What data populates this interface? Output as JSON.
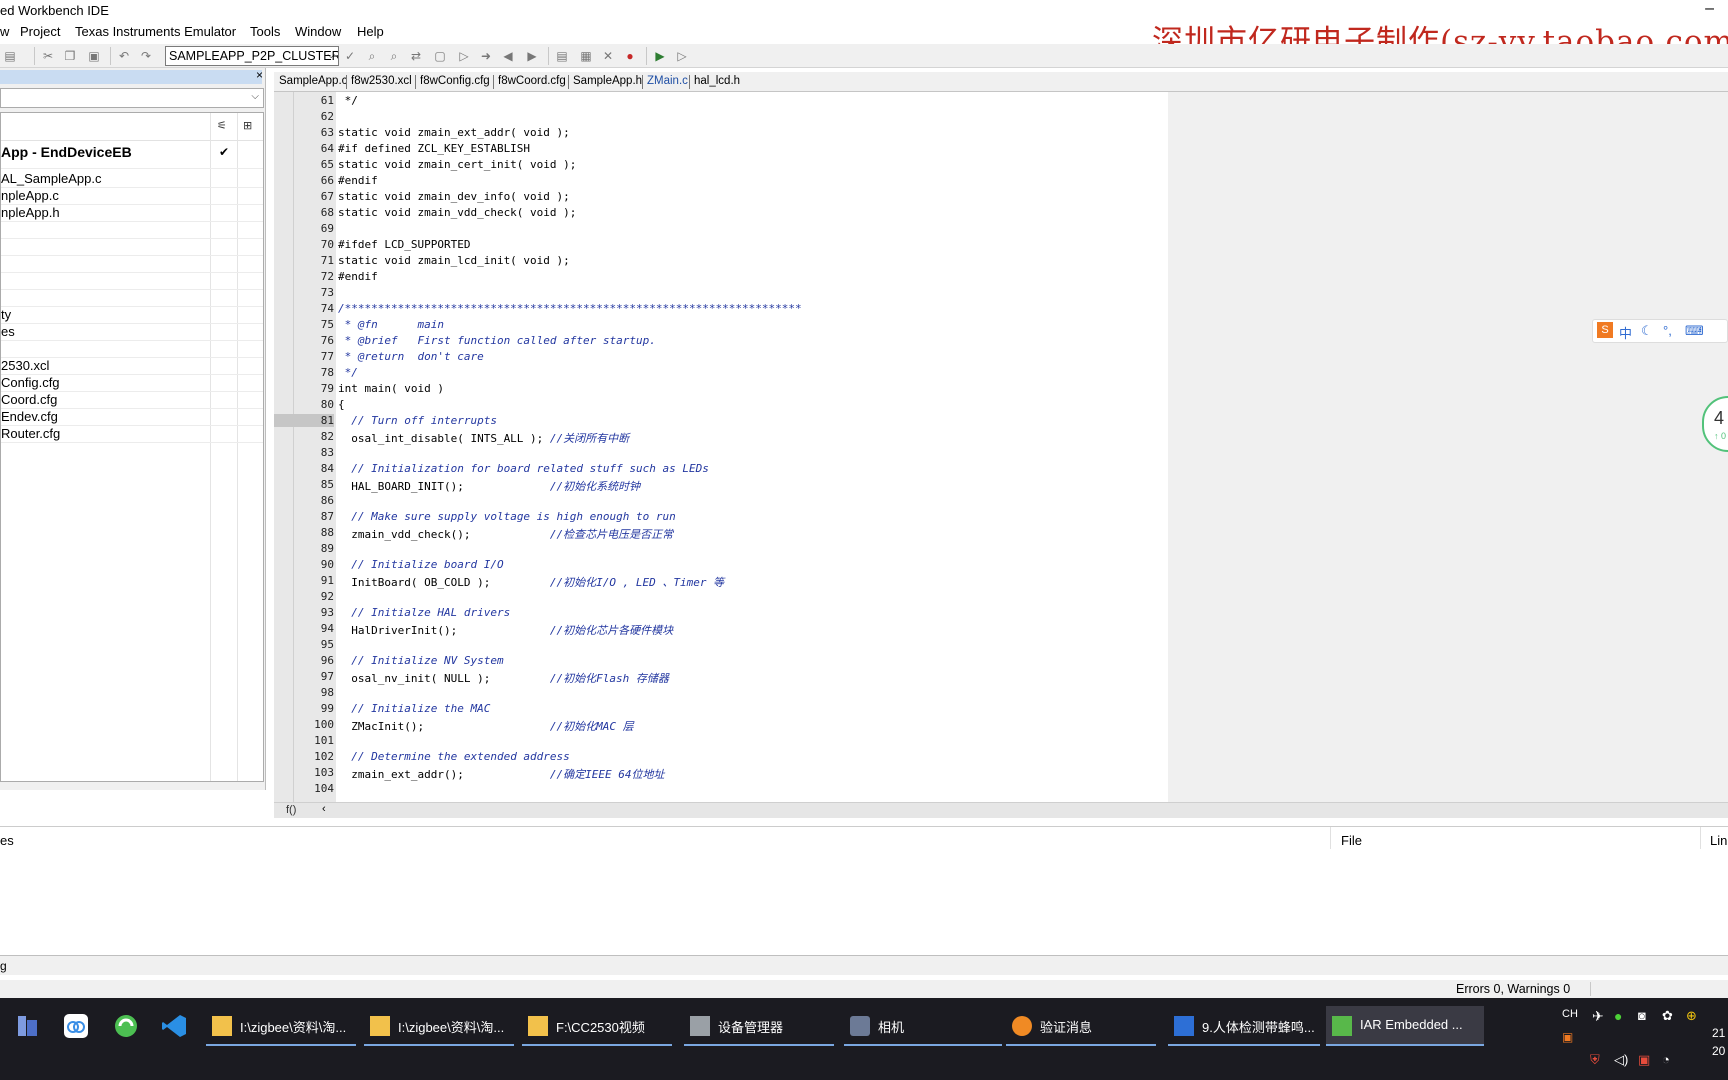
{
  "window": {
    "title": "ed Workbench IDE",
    "minimize_glyph": "–"
  },
  "menu": [
    "w",
    "Project",
    "Texas Instruments Emulator",
    "Tools",
    "Window",
    "Help"
  ],
  "watermark": "深圳市亿研电子制作(sz-yy.taobao.com",
  "toolbar": {
    "config_combo": "SAMPLEAPP_P2P_CLUSTER"
  },
  "workspace": {
    "close_glyph": "×",
    "project": "App - EndDeviceEB",
    "check": "✔",
    "files": [
      "AL_SampleApp.c",
      "npleApp.c",
      "npleApp.h",
      "",
      "",
      "",
      "",
      "",
      "ty",
      "es",
      "",
      "2530.xcl",
      "Config.cfg",
      "Coord.cfg",
      "Endev.cfg",
      "Router.cfg"
    ]
  },
  "tabs": [
    "SampleApp.c",
    "f8w2530.xcl",
    "f8wConfig.cfg",
    "f8wCoord.cfg",
    "SampleApp.h",
    "ZMain.c",
    "hal_lcd.h"
  ],
  "active_tab": "ZMain.c",
  "editor": {
    "current_line": 81,
    "lines": [
      {
        "n": "61",
        "code": " */",
        "cm": ""
      },
      {
        "n": "62",
        "code": "",
        "cm": ""
      },
      {
        "n": "63",
        "code": "static void zmain_ext_addr( void );",
        "cm": ""
      },
      {
        "n": "64",
        "code": "#if defined ZCL_KEY_ESTABLISH",
        "cm": ""
      },
      {
        "n": "65",
        "code": "static void zmain_cert_init( void );",
        "cm": ""
      },
      {
        "n": "66",
        "code": "#endif",
        "cm": ""
      },
      {
        "n": "67",
        "code": "static void zmain_dev_info( void );",
        "cm": ""
      },
      {
        "n": "68",
        "code": "static void zmain_vdd_check( void );",
        "cm": ""
      },
      {
        "n": "69",
        "code": "",
        "cm": ""
      },
      {
        "n": "70",
        "code": "#ifdef LCD_SUPPORTED",
        "cm": ""
      },
      {
        "n": "71",
        "code": "static void zmain_lcd_init( void );",
        "cm": ""
      },
      {
        "n": "72",
        "code": "#endif",
        "cm": ""
      },
      {
        "n": "73",
        "code": "",
        "cm": ""
      },
      {
        "n": "74",
        "code": "",
        "cm": "/*********************************************************************"
      },
      {
        "n": "75",
        "code": "",
        "cm": " * @fn      main"
      },
      {
        "n": "76",
        "code": "",
        "cm": " * @brief   First function called after startup."
      },
      {
        "n": "77",
        "code": "",
        "cm": " * @return  don't care"
      },
      {
        "n": "78",
        "code": "",
        "cm": " */"
      },
      {
        "n": "79",
        "code": "int main( void )",
        "cm": ""
      },
      {
        "n": "80",
        "code": "{",
        "cm": ""
      },
      {
        "n": "81",
        "code": "  ",
        "cm": "// Turn off interrupts"
      },
      {
        "n": "82",
        "code": "  osal_int_disable( INTS_ALL ); ",
        "cm": "//关闭所有中断"
      },
      {
        "n": "83",
        "code": "",
        "cm": ""
      },
      {
        "n": "84",
        "code": "  ",
        "cm": "// Initialization for board related stuff such as LEDs"
      },
      {
        "n": "85",
        "code": "  HAL_BOARD_INIT();             ",
        "cm": "//初始化系统时钟"
      },
      {
        "n": "86",
        "code": "",
        "cm": ""
      },
      {
        "n": "87",
        "code": "  ",
        "cm": "// Make sure supply voltage is high enough to run"
      },
      {
        "n": "88",
        "code": "  zmain_vdd_check();            ",
        "cm": "//检查芯片电压是否正常"
      },
      {
        "n": "89",
        "code": "",
        "cm": ""
      },
      {
        "n": "90",
        "code": "  ",
        "cm": "// Initialize board I/O"
      },
      {
        "n": "91",
        "code": "  InitBoard( OB_COLD );         ",
        "cm": "//初始化I/O , LED 、Timer 等"
      },
      {
        "n": "92",
        "code": "",
        "cm": ""
      },
      {
        "n": "93",
        "code": "  ",
        "cm": "// Initialze HAL drivers"
      },
      {
        "n": "94",
        "code": "  HalDriverInit();              ",
        "cm": "//初始化芯片各硬件模块"
      },
      {
        "n": "95",
        "code": "",
        "cm": ""
      },
      {
        "n": "96",
        "code": "  ",
        "cm": "// Initialize NV System"
      },
      {
        "n": "97",
        "code": "  osal_nv_init( NULL );         ",
        "cm": "//初始化Flash 存储器"
      },
      {
        "n": "98",
        "code": "",
        "cm": ""
      },
      {
        "n": "99",
        "code": "  ",
        "cm": "// Initialize the MAC"
      },
      {
        "n": "100",
        "code": "  ZMacInit();                   ",
        "cm": "//初始化MAC 层"
      },
      {
        "n": "101",
        "code": "",
        "cm": ""
      },
      {
        "n": "102",
        "code": "  ",
        "cm": "// Determine the extended address"
      },
      {
        "n": "103",
        "code": "  zmain_ext_addr();             ",
        "cm": "//确定IEEE 64位地址"
      },
      {
        "n": "104",
        "code": "",
        "cm": ""
      }
    ]
  },
  "hscroll": {
    "fx": "f()",
    "left": "‹"
  },
  "messages": {
    "col1": "es",
    "col2": "File",
    "col3": "Lin"
  },
  "msg_tab": "g",
  "status": "Errors 0, Warnings 0",
  "ime": [
    "中",
    "☾",
    "°,",
    "⌨"
  ],
  "badge": {
    "big": "4",
    "small": "↑ 0"
  },
  "taskbar": {
    "tasks": [
      {
        "label": "I:\\zigbee\\资料\\淘...",
        "color": "#f2c14b"
      },
      {
        "label": "I:\\zigbee\\资料\\淘...",
        "color": "#f2c14b"
      },
      {
        "label": "F:\\CC2530视频",
        "color": "#f2c14b"
      },
      {
        "label": "设备管理器",
        "color": "#9aa0a6"
      },
      {
        "label": "相机",
        "color": "#6c7a96"
      },
      {
        "label": "验证消息",
        "color": "#f08a24"
      },
      {
        "label": "9.人体检测带蜂鸣...",
        "color": "#2d6fd6"
      },
      {
        "label": "IAR Embedded ...",
        "color": "#58b84a"
      }
    ],
    "tray_lang": "CH",
    "clock_time": "21",
    "clock_date": "20"
  }
}
